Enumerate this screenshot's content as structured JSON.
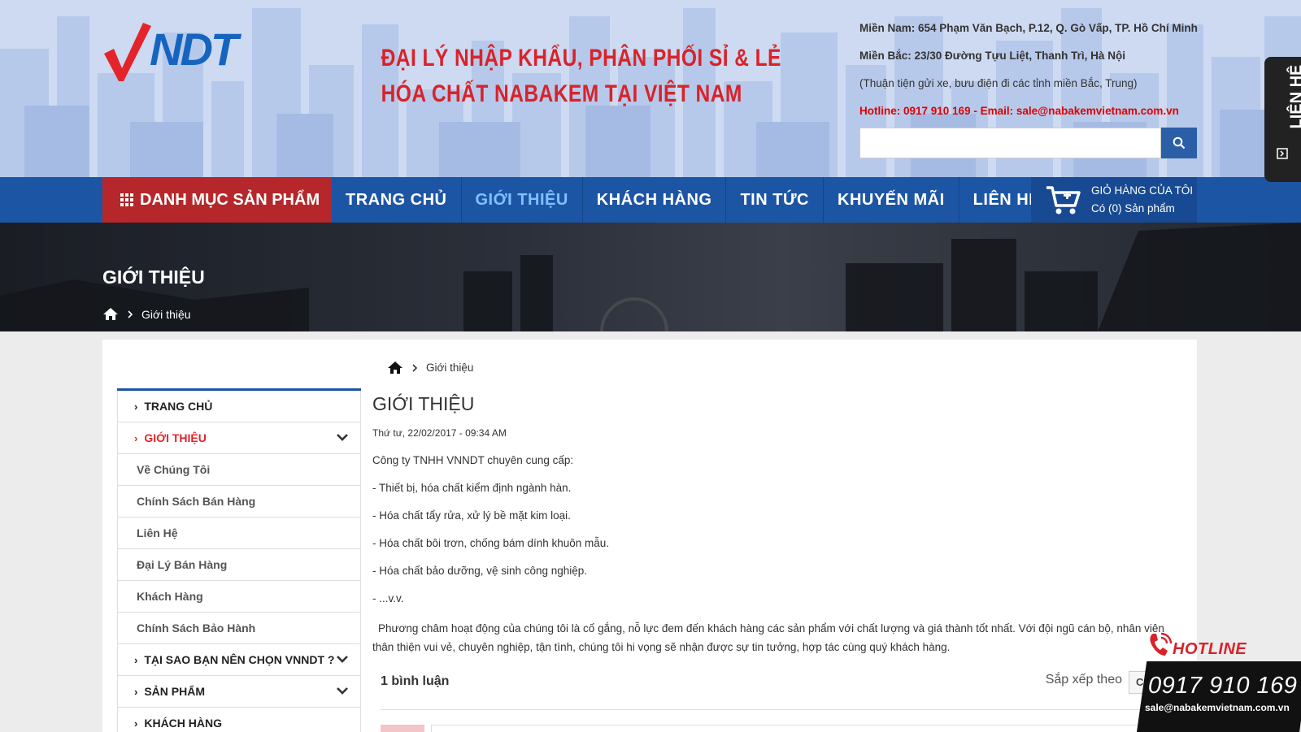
{
  "header": {
    "logo_text": "NDT",
    "slogan_line1": "ĐẠI LÝ NHẬP KHẨU, PHÂN PHỐI SỈ & LẺ",
    "slogan_line2": "HÓA CHẤT NABAKEM TẠI VIỆT NAM",
    "address_south": "Miền Nam: 654 Phạm Văn Bạch, P.12, Q. Gò Vấp, TP. Hồ Chí Minh",
    "address_north": "Miền Bắc: 23/30 Đường Tựu Liệt, Thanh Trì, Hà Nội",
    "shipping_note": "(Thuận tiện gửi xe, bưu điện đi các tỉnh miền Bắc, Trung)",
    "hotline_email": "Hotline: 0917 910 169 - Email: sale@nabakemvietnam.com.vn",
    "search_placeholder": ""
  },
  "nav": {
    "category_label": "DANH MỤC SẢN PHẨM",
    "items": [
      {
        "label": "TRANG CHỦ"
      },
      {
        "label": "GIỚI THIỆU"
      },
      {
        "label": "KHÁCH HÀNG"
      },
      {
        "label": "TIN TỨC"
      },
      {
        "label": "KHUYẾN MÃI"
      },
      {
        "label": "LIÊN HỆ"
      }
    ],
    "cart_title": "GIỎ HÀNG CỦA TÔI",
    "cart_count": "Có (0) Sản phẩm"
  },
  "banner": {
    "title": "GIỚI THIỆU",
    "breadcrumb": "Giới thiệu"
  },
  "sidebar": {
    "items": [
      {
        "label": "TRANG CHỦ"
      },
      {
        "label": "GIỚI THIỆU"
      },
      {
        "label": "Về Chúng Tôi"
      },
      {
        "label": "Chính Sách Bán Hàng"
      },
      {
        "label": "Liên Hệ"
      },
      {
        "label": "Đại Lý Bán Hàng"
      },
      {
        "label": "Khách Hàng"
      },
      {
        "label": "Chính Sách Bảo Hành"
      },
      {
        "label": "TẠI SAO BẠN NÊN CHỌN VNNDT ?"
      },
      {
        "label": "SẢN PHẨM"
      },
      {
        "label": "KHÁCH HÀNG"
      }
    ]
  },
  "content": {
    "breadcrumb": "Giới thiệu",
    "title": "GIỚI THIỆU",
    "date": "Thứ tư, 22/02/2017 - 09:34 AM",
    "lines": [
      "Công ty TNHH VNNDT chuyên cung cấp:",
      "- Thiết bị, hóa chất kiểm định ngành hàn.",
      "- Hóa chất tẩy rửa, xử lý bề mặt kim loại.",
      "- Hóa chất bôi trơn, chống bám dính khuôn mẫu.",
      "- Hóa chất bảo dưỡng, vệ sinh công nghiệp.",
      "- ...v.v."
    ],
    "paragraph": "Phương châm hoạt động của chúng tôi là cố gắng, nỗ lực đem đến khách hàng các sản phẩm   với chất lượng và giá thành tốt nhất. Với đội ngũ cán bộ, nhân viên thân thiện vui vẻ, chuyên nghiệp,  tận tình, chúng tôi hi vọng sẽ nhận được sự tin tưởng, hợp tác cùng quý khách hàng."
  },
  "comments": {
    "count": "1 bình luận",
    "sort_label": "Sắp xếp theo",
    "sort_value": "Cũ nhất"
  },
  "side_tab": {
    "label": "LIÊN HỆ"
  },
  "hotline_widget": {
    "title": "HOTLINE",
    "phone": "0917 910 169",
    "email": "sale@nabakemvietnam.com.vn"
  },
  "colors": {
    "brand_blue": "#1d55a5",
    "brand_red": "#d8232a",
    "category_red": "#b5272a"
  }
}
